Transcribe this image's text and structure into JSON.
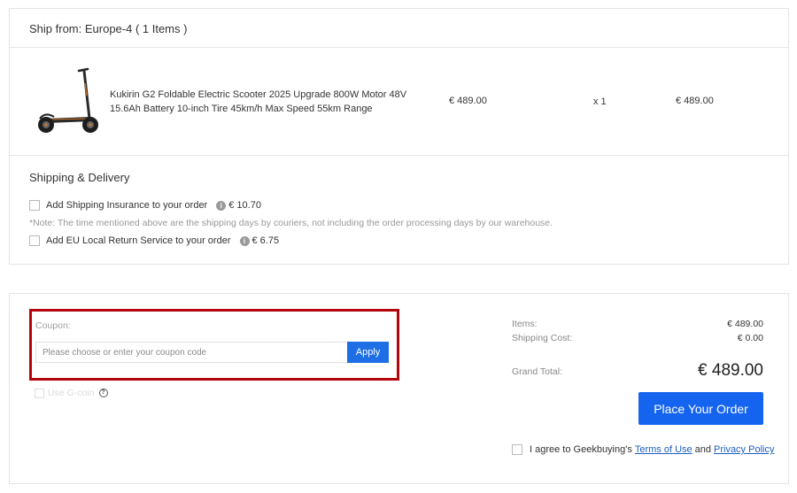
{
  "shipment": {
    "header": "Ship from: Europe-4 ( 1 Items )",
    "product": {
      "name": "Kukirin G2 Foldable Electric Scooter 2025 Upgrade 800W Motor 48V 15.6Ah Battery 10-inch Tire 45km/h Max Speed 55km Range",
      "unit_price": "€ 489.00",
      "quantity": "x 1",
      "line_total": "€ 489.00",
      "image_icon": "electric-scooter"
    }
  },
  "shipping": {
    "title": "Shipping & Delivery",
    "insurance_label": "Add Shipping Insurance to your order",
    "insurance_price": "€ 10.70",
    "note": "*Note: The time mentioned above are the shipping days by couriers, not including the order processing days by our warehouse.",
    "return_label": "Add EU Local Return Service to your order",
    "return_price": "€ 6.75",
    "info_icon": "i"
  },
  "coupon": {
    "label": "Coupon:",
    "placeholder": "Please choose or enter your coupon code",
    "value": "",
    "apply_label": "Apply",
    "gcoin_label": "Use G-coin",
    "help_icon": "?"
  },
  "summary": {
    "items_label": "Items:",
    "items_value": "€ 489.00",
    "shipping_label": "Shipping Cost:",
    "shipping_value": "€ 0.00",
    "grand_label": "Grand Total:",
    "grand_value": "€ 489.00",
    "place_order_label": "Place Your Order",
    "agree_text": "I agree to Geekbuying's",
    "terms_label": "Terms of Use",
    "and_text": "and",
    "privacy_label": "Privacy Policy"
  },
  "colors": {
    "accent": "#1464f0",
    "highlight_border": "#b3060c",
    "link": "#1e5fbf"
  }
}
